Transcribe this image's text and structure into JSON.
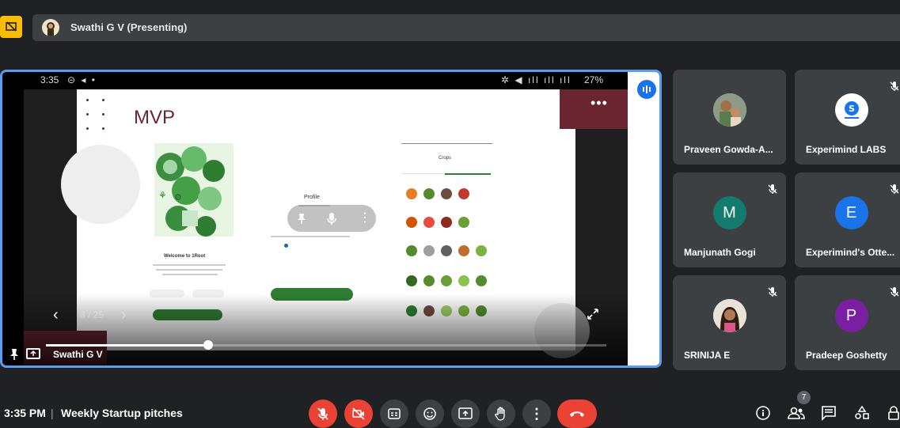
{
  "presenter": {
    "label": "Swathi G V (Presenting)"
  },
  "phone_status": {
    "time": "3:35",
    "battery": "27%"
  },
  "slide": {
    "title": "MVP",
    "counter": "8 / 25",
    "profile_heading": "Profile",
    "welcome_heading": "Welcome to 1Root",
    "crops_heading": "Crops"
  },
  "main_tile": {
    "name": "Swathi G V",
    "progress": 0.29
  },
  "participants": [
    {
      "name": "Praveen Gowda-A...",
      "avatar": "photo",
      "muted": false
    },
    {
      "name": "Experimind LABS",
      "avatar": "logo",
      "muted": true
    },
    {
      "name": "Manjunath Gogi",
      "avatar": "M",
      "avatar_color": "#137c6e",
      "muted": true
    },
    {
      "name": "Experimind's Otte...",
      "avatar": "E",
      "avatar_color": "#1a73e8",
      "muted": true
    },
    {
      "name": "SRINIJA E",
      "avatar": "photo",
      "muted": true
    },
    {
      "name": "Pradeep Goshetty",
      "avatar": "P",
      "avatar_color": "#7b1fa2",
      "muted": true
    }
  ],
  "bottom_bar": {
    "time": "3:35 PM",
    "separator": "|",
    "meeting_title": "Weekly Startup pitches",
    "people_count": "7"
  },
  "colors": {
    "background": "#202124",
    "tile": "#3c4043",
    "accent_blue": "#5c9cf0",
    "danger_red": "#ea4335",
    "present_yellow": "#fbbc04",
    "slide_maroon": "#6b2530"
  },
  "icons": [
    "present-screen-icon",
    "mic-off-icon",
    "camera-off-icon",
    "captions-icon",
    "emoji-icon",
    "present-now-icon",
    "raise-hand-icon",
    "more-options-icon",
    "end-call-icon",
    "info-icon",
    "people-icon",
    "chat-icon",
    "activities-icon",
    "host-controls-icon",
    "pin-icon",
    "expand-icon"
  ]
}
